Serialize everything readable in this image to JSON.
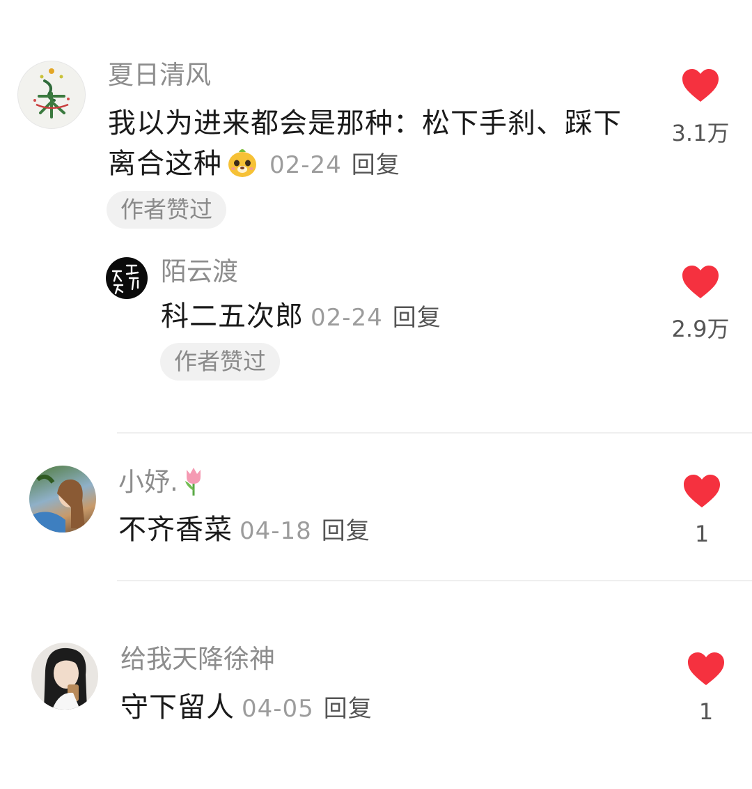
{
  "accent_color": "#f5313f",
  "comments": [
    {
      "username": "夏日清风",
      "text": "我以为进来都会是那种：松下手刹、踩下离合这种",
      "emoji": "dog-face-emoji",
      "date": "02-24",
      "reply_label": "回复",
      "badge": "作者赞过",
      "likes": "3.1万",
      "reply": {
        "username": "陌云渡",
        "text": "科二五次郎",
        "date": "02-24",
        "reply_label": "回复",
        "badge": "作者赞过",
        "likes": "2.9万"
      }
    },
    {
      "username": "小妤.",
      "username_icon": "tulip-emoji",
      "text": "不齐香菜",
      "date": "04-18",
      "reply_label": "回复",
      "likes": "1"
    },
    {
      "username": "给我天降徐神",
      "text": "守下留人",
      "date": "04-05",
      "reply_label": "回复",
      "likes": "1"
    }
  ]
}
